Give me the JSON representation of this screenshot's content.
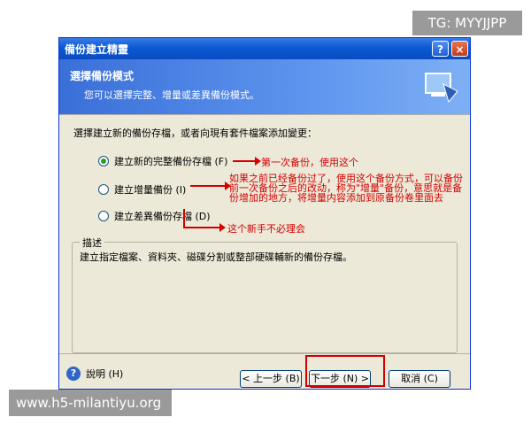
{
  "watermarks": {
    "top": "TG: MYYJJPP",
    "bottom": "www.h5-milantiyu.org"
  },
  "window": {
    "title": "備份建立精靈",
    "buttons": {
      "help": "?",
      "close": "×"
    },
    "header": {
      "title": "選擇備份模式",
      "subtitle": "您可以選擇完整、增量或差異備份模式。"
    },
    "prompt": "選擇建立新的備份存檔，或者向現有套件檔案添加變更：",
    "options": [
      {
        "label": "建立新的完整備份存檔 (F)",
        "selected": true
      },
      {
        "label": "建立增量備份 (I)",
        "selected": false
      },
      {
        "label": "建立差異備份存檔 (D)",
        "selected": false
      }
    ],
    "annotations": {
      "full": "第一次备份，使用这个",
      "incremental": "如果之前已经备份过了，使用这个备份方式，可以备份前一次备份之后的改动，称为\"增量\"备份，意思就是备份增加的地方，将增量内容添加到原备份卷里面去",
      "differential": "这个新手不必理会"
    },
    "description": {
      "label": "描述",
      "text": "建立指定檔案、資料夾、磁碟分割或整部硬碟輔新的備份存檔。"
    },
    "footer": {
      "help": "說明 (H)",
      "back": "< 上一步 (B)",
      "next": "下一步 (N) >",
      "cancel": "取消 (C)"
    }
  }
}
